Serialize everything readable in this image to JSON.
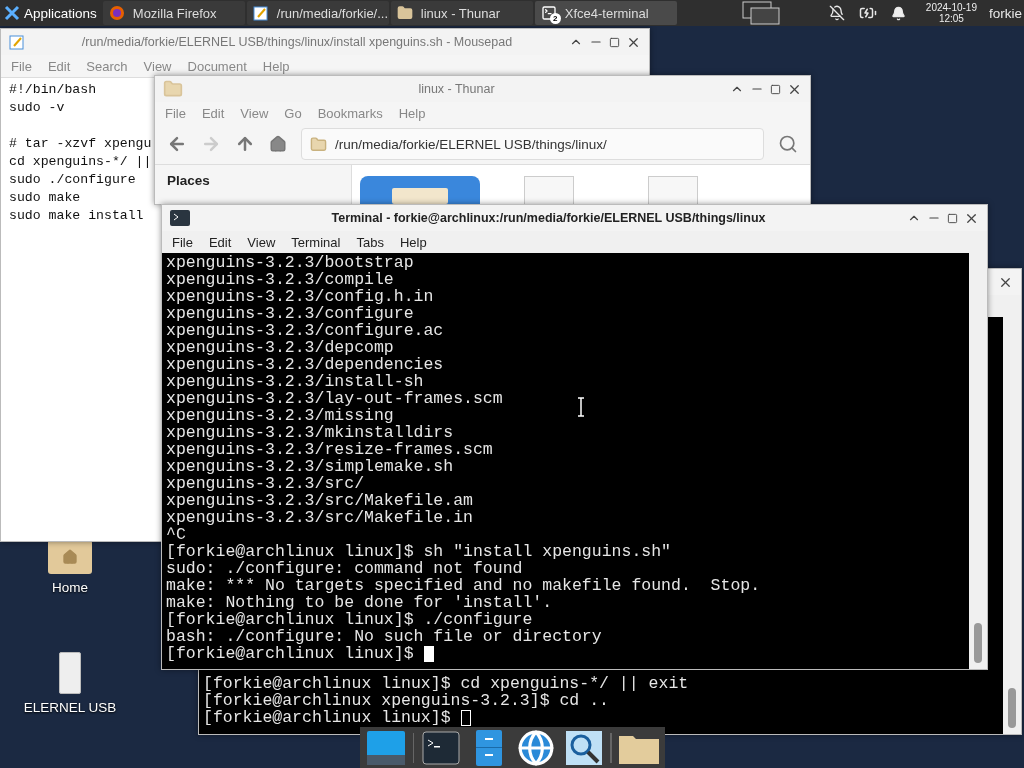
{
  "panel": {
    "apps_menu": "Applications",
    "tasks": [
      {
        "label": "Mozilla Firefox",
        "kind": "firefox",
        "selected": false
      },
      {
        "label": "/run/media/forkie/...",
        "kind": "editor",
        "selected": false
      },
      {
        "label": "linux - Thunar",
        "kind": "folder",
        "selected": false
      },
      {
        "label": "Xfce4-terminal",
        "kind": "terminal",
        "selected": true,
        "badge": "2"
      }
    ],
    "date": "2024-10-19",
    "time": "12:05",
    "user": "forkie"
  },
  "desktop_icons": [
    {
      "label": "Home",
      "kind": "home"
    },
    {
      "label": "ELERNEL USB",
      "kind": "usb"
    }
  ],
  "mousepad": {
    "title": "/run/media/forkie/ELERNEL USB/things/linux/install xpenguins.sh - Mousepad",
    "menu": [
      "File",
      "Edit",
      "Search",
      "View",
      "Document",
      "Help"
    ],
    "blocks": [
      [
        "#!/bin/bash",
        "sudo -v"
      ],
      [
        "# tar -xzvf xpengu",
        "cd xpenguins-*/ ||",
        "sudo ./configure",
        "sudo make",
        "sudo make install"
      ]
    ]
  },
  "thunar": {
    "title": "linux - Thunar",
    "menu": [
      "File",
      "Edit",
      "View",
      "Go",
      "Bookmarks",
      "Help"
    ],
    "path": "/run/media/forkie/ELERNEL USB/things/linux/",
    "sidebar_heading": "Places"
  },
  "terminal_back": {
    "lines": [
      "[forkie@archlinux linux]$ cd xpenguins-*/ || exit",
      "[forkie@archlinux xpenguins-3.2.3]$ cd ..",
      "[forkie@archlinux linux]$"
    ]
  },
  "terminal": {
    "title": "Terminal - forkie@archlinux:/run/media/forkie/ELERNEL USB/things/linux",
    "menu": [
      "File",
      "Edit",
      "View",
      "Terminal",
      "Tabs",
      "Help"
    ],
    "lines": [
      "xpenguins-3.2.3/bootstrap",
      "xpenguins-3.2.3/compile",
      "xpenguins-3.2.3/config.h.in",
      "xpenguins-3.2.3/configure",
      "xpenguins-3.2.3/configure.ac",
      "xpenguins-3.2.3/depcomp",
      "xpenguins-3.2.3/dependencies",
      "xpenguins-3.2.3/install-sh",
      "xpenguins-3.2.3/lay-out-frames.scm",
      "xpenguins-3.2.3/missing",
      "xpenguins-3.2.3/mkinstalldirs",
      "xpenguins-3.2.3/resize-frames.scm",
      "xpenguins-3.2.3/simplemake.sh",
      "xpenguins-3.2.3/src/",
      "xpenguins-3.2.3/src/Makefile.am",
      "xpenguins-3.2.3/src/Makefile.in",
      "^C",
      "[forkie@archlinux linux]$ sh \"install xpenguins.sh\"",
      "sudo: ./configure: command not found",
      "make: *** No targets specified and no makefile found.  Stop.",
      "make: Nothing to be done for 'install'.",
      "[forkie@archlinux linux]$ ./configure",
      "bash: ./configure: No such file or directory",
      "[forkie@archlinux linux]$"
    ]
  },
  "dock": {
    "items": [
      {
        "kind": "desktop"
      },
      {
        "kind": "terminal"
      },
      {
        "kind": "files"
      },
      {
        "kind": "browser"
      },
      {
        "kind": "search"
      },
      {
        "kind": "folder"
      }
    ]
  }
}
